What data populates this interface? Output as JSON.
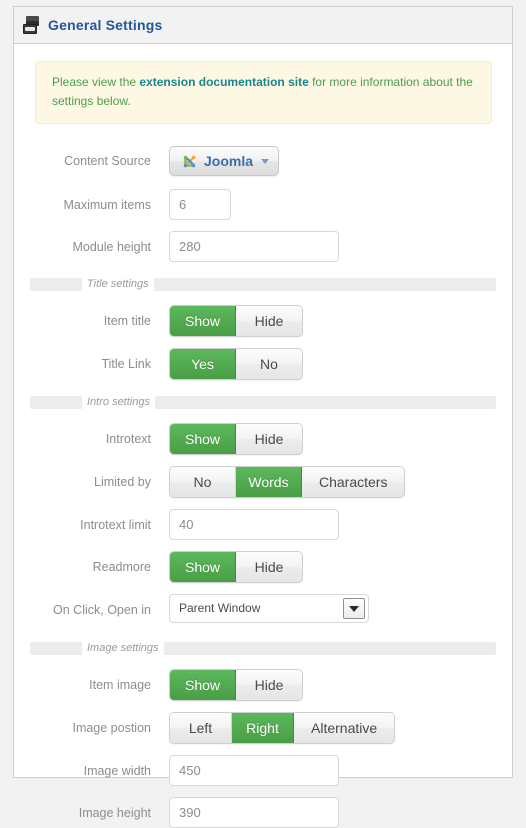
{
  "header": {
    "title": "General Settings",
    "icon": "stacked-modules-icon"
  },
  "notice": {
    "text_before": "Please view the ",
    "link_text": "extension documentation site",
    "text_after": " for more information about the settings below."
  },
  "sections": {
    "title_settings": "Title settings",
    "intro_settings": "Intro settings",
    "image_settings": "Image settings"
  },
  "fields": {
    "content_source": {
      "label": "Content Source",
      "value": "Joomla",
      "icon": "joomla-logo-icon"
    },
    "maximum_items": {
      "label": "Maximum items",
      "value": "6"
    },
    "module_height": {
      "label": "Module height",
      "value": "280"
    },
    "item_title": {
      "label": "Item title",
      "options": [
        "Show",
        "Hide"
      ],
      "selected": "Show"
    },
    "title_link": {
      "label": "Title Link",
      "options": [
        "Yes",
        "No"
      ],
      "selected": "Yes"
    },
    "introtext": {
      "label": "Introtext",
      "options": [
        "Show",
        "Hide"
      ],
      "selected": "Show"
    },
    "limited_by": {
      "label": "Limited by",
      "options": [
        "No",
        "Words",
        "Characters"
      ],
      "selected": "Words"
    },
    "introtext_limit": {
      "label": "Introtext limit",
      "value": "40"
    },
    "readmore": {
      "label": "Readmore",
      "options": [
        "Show",
        "Hide"
      ],
      "selected": "Show"
    },
    "on_click_open_in": {
      "label": "On Click, Open in",
      "value": "Parent Window"
    },
    "item_image": {
      "label": "Item image",
      "options": [
        "Show",
        "Hide"
      ],
      "selected": "Show"
    },
    "image_position": {
      "label": "Image postion",
      "options": [
        "Left",
        "Right",
        "Alternative"
      ],
      "selected": "Right"
    },
    "image_width": {
      "label": "Image width",
      "value": "450"
    },
    "image_height": {
      "label": "Image height",
      "value": "390"
    }
  },
  "colors": {
    "accent_green": "#4a9e45",
    "title_blue": "#25559a",
    "notice_bg": "#fcf8e3",
    "notice_text": "#4f9c51",
    "link_teal": "#19868e"
  }
}
